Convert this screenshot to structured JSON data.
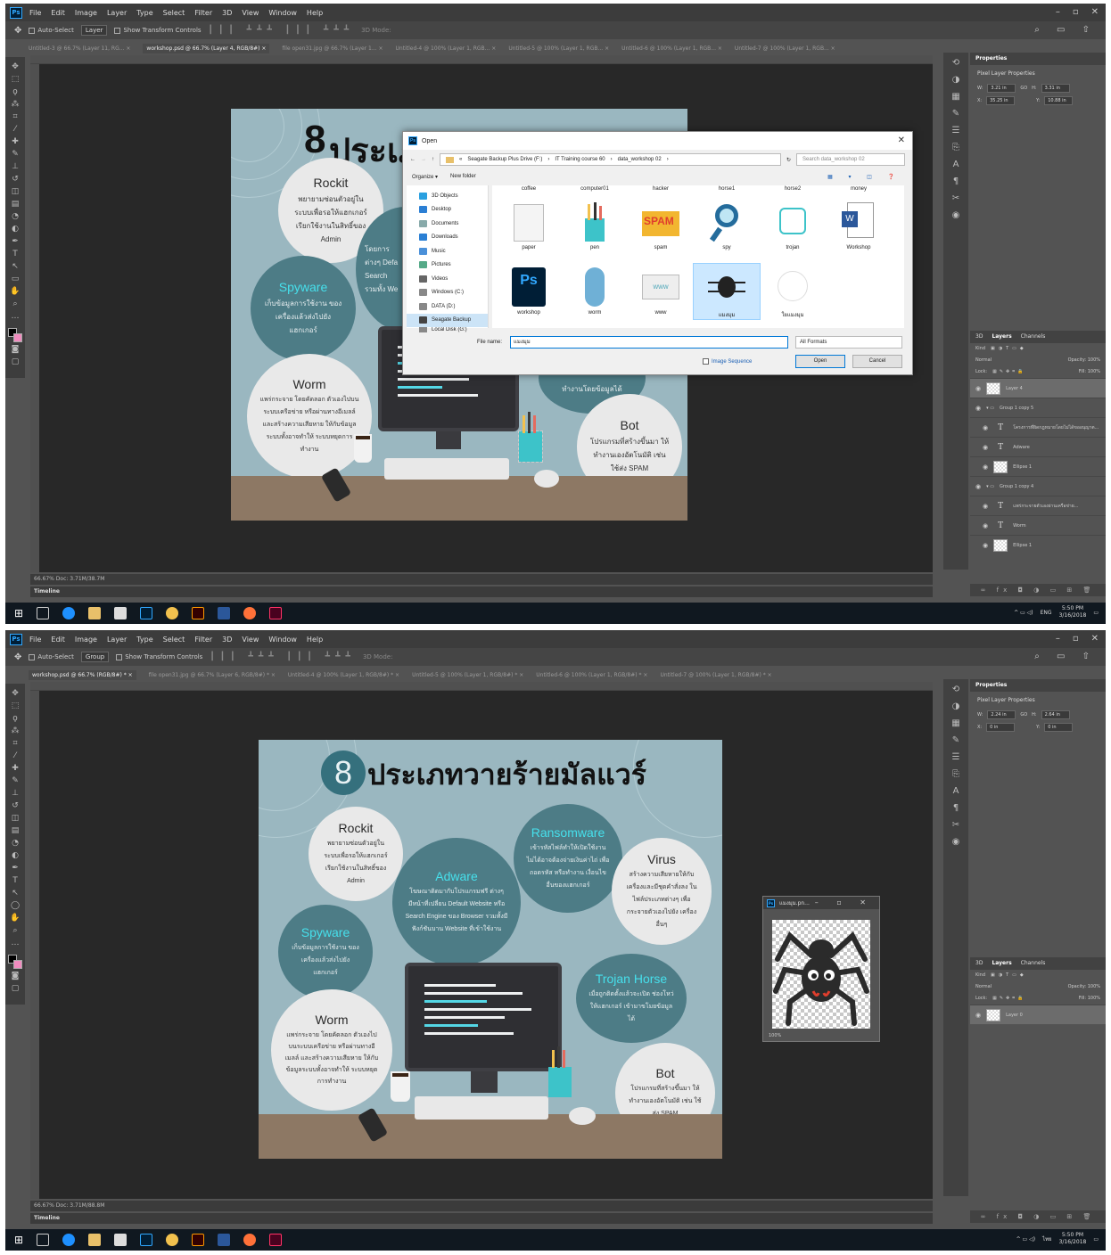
{
  "menu": [
    "File",
    "Edit",
    "Image",
    "Layer",
    "Type",
    "Select",
    "Filter",
    "3D",
    "View",
    "Window",
    "Help"
  ],
  "window_controls": [
    "–",
    "▫",
    "✕"
  ],
  "taskbar": {
    "time": "5:50 PM",
    "date": "3/16/2018",
    "lang1": "ENG",
    "time2": "5:50 PM",
    "date2": "3/16/2018",
    "lang2": "ไทย"
  },
  "shot1": {
    "options": {
      "auto_select": "Auto-Select",
      "target": "Layer",
      "transform": "Show Transform Controls",
      "mode3d": "3D Mode:"
    },
    "tabs": [
      "Untitled-3 @ 66.7% (Layer 11, RG... ×",
      "workshop.psd @ 66.7% (Layer 4, RGB/8#) ×",
      "file open31.jpg @ 66.7% (Layer 1... ×",
      "Untitled-4 @ 100% (Layer 1, RGB... ×",
      "Untitled-5 @ 100% (Layer 1, RGB... ×",
      "Untitled-6 @ 100% (Layer 1, RGB... ×",
      "Untitled-7 @ 100% (Layer 1, RGB... ×"
    ],
    "status": "66.67%      Doc: 3.71M/38.7M",
    "timeline": "Timeline",
    "properties": {
      "title": "Properties",
      "sub": "Pixel Layer Properties",
      "w_label": "W:",
      "w": "3.21 in",
      "go": "GO",
      "h_label": "H:",
      "h": "3.31 in",
      "x_label": "X:",
      "x": "35.25 in",
      "y_label": "Y:",
      "y": "10.88 in"
    },
    "layers_tabs": [
      "3D",
      "Layers",
      "Channels"
    ],
    "layers_ctrl": {
      "kind": "Kind",
      "blend": "Normal",
      "opacity": "Opacity: 100%",
      "lock": "Lock:",
      "fill": "Fill: 100%"
    },
    "layers": [
      {
        "name": "Layer 4",
        "type": "pixel"
      },
      {
        "name": "Group 1 copy 5",
        "type": "group"
      },
      {
        "name": "โครงการที่ผิดกฎหมายโดยไม่ได้ขออนุญาต...",
        "type": "text"
      },
      {
        "name": "Adware",
        "type": "text"
      },
      {
        "name": "Ellipse 1",
        "type": "pixel"
      },
      {
        "name": "Group 1 copy 4",
        "type": "group"
      },
      {
        "name": "แพร่กระจายตัวเองผ่านเครือข่าย...",
        "type": "text"
      },
      {
        "name": "Worm",
        "type": "text"
      },
      {
        "name": "Ellipse 1",
        "type": "pixel"
      }
    ],
    "dialog": {
      "title": "Open",
      "path": [
        "«",
        "Seagate Backup Plus Drive (F:)",
        "›",
        "IT Training course 60",
        "›",
        "data_workshop 02",
        "›"
      ],
      "search": "Search data_workshop 02",
      "organize": "Organize ▾",
      "new_folder": "New folder",
      "nav": [
        "3D Objects",
        "Desktop",
        "Documents",
        "Downloads",
        "Music",
        "Pictures",
        "Videos",
        "Windows (C:)",
        "DATA (D:)",
        "Seagate Backup",
        "Local Disk (G:)"
      ],
      "top_row": [
        "coffee",
        "computer01",
        "hacker",
        "horse1",
        "horse2",
        "money"
      ],
      "files": [
        "paper",
        "pen",
        "spam",
        "spy",
        "trojan",
        "Workshop"
      ],
      "files2": [
        "workshop",
        "worm",
        "www",
        "แมงมุม",
        "ใยแมงมุม"
      ],
      "filename_label": "File name:",
      "filename": "แมงมุม",
      "filter": "All Formats",
      "image_sequence": "Image Sequence",
      "open": "Open",
      "cancel": "Cancel"
    },
    "doc": {
      "num": "8",
      "title": "ประเภท"
    },
    "bubbles": [
      {
        "title": "Rockit",
        "body": "พยายามซ่อนตัวอยู่ใน ระบบเพื่อรอให้แฮกเกอร์ เรียกใช้งานในสิทธิ์ของ Admin"
      },
      {
        "title": "Spyware",
        "body": "เก็บข้อมูลการใช้งาน ของเครื่องแล้วส่งไปยัง แฮกเกอร์"
      },
      {
        "title": "Worm",
        "body": "แพร่กระจาย โดยคัดลอก ตัวเองไปบนระบบเครือข่าย หรือผ่านทางอีเมลล์ และสร้างความเสียหาย ให้กับข้อมูลระบบทั้งอาจทำให้ ระบบหยุดการทำงาน"
      },
      {
        "title": "Bot",
        "body": "โปรแกรมที่สร้างขึ้นมา ให้ทำงานเองอัตโนมัติ เช่น ใช้ส่ง SPAM"
      },
      {
        "title": "",
        "body": "ทำงานโดยข้อมูลได้"
      },
      {
        "title": "",
        "body": "โดยการ ต่างๆ Defa Search รวมทั้ง We"
      }
    ]
  },
  "shot2": {
    "options": {
      "auto_select": "Auto-Select",
      "target": "Group",
      "transform": "Show Transform Controls",
      "mode3d": "3D Mode:"
    },
    "tabs": [
      "workshop.psd @ 66.7% (RGB/8#) * ×",
      "file open31.jpg @ 66.7% (Layer 6, RGB/8#) * ×",
      "Untitled-4 @ 100% (Layer 1, RGB/8#) * ×",
      "Untitled-5 @ 100% (Layer 1, RGB/8#) * ×",
      "Untitled-6 @ 100% (Layer 1, RGB/8#) * ×",
      "Untitled-7 @ 100% (Layer 1, RGB/8#) * ×"
    ],
    "status": "66.67%      Doc: 3.71M/88.8M",
    "timeline": "Timeline",
    "properties": {
      "title": "Properties",
      "sub": "Pixel Layer Properties",
      "w_label": "W:",
      "w": "2.24 in",
      "go": "GO",
      "h_label": "H:",
      "h": "2.64 in",
      "x_label": "X:",
      "x": "0 in",
      "y_label": "Y:",
      "y": "0 in"
    },
    "layers_tabs": [
      "3D",
      "Layers",
      "Channels"
    ],
    "layers_ctrl": {
      "kind": "Kind",
      "blend": "Normal",
      "opacity": "Opacity: 100%",
      "lock": "Lock:",
      "fill": "Fill: 100%"
    },
    "layers": [
      {
        "name": "Layer 0",
        "type": "pixel"
      }
    ],
    "floatwin": {
      "title": "แมงมุม.pn...",
      "zoom": "100%"
    },
    "doc": {
      "num": "8",
      "title": "ประเภทวายร้ายมัลแวร์"
    },
    "bubbles": [
      {
        "title": "Rockit",
        "body": "พยายามซ่อนตัวอยู่ใน ระบบเพื่อรอให้แฮกเกอร์ เรียกใช้งานในสิทธิ์ของ Admin"
      },
      {
        "title": "Adware",
        "body": "โฆษณาติดมากับโปรแกรมฟรี ต่างๆ มีหน้าที่เปลี่ยน Default Website หรือ Search Engine ของ Browser รวมทั้งมีฟังก์ชันบาน Website ที่เข้าใช้งาน"
      },
      {
        "title": "Ransomware",
        "body": "เข้ารหัสไฟล์ทำให้เปิดใช้งาน ไม่ได้อาจต้องจ่ายเงินค่าไถ่ เพื่อถอดรหัส หรือทำงาน เงื่อนไขอื่นของแฮกเกอร์"
      },
      {
        "title": "Virus",
        "body": "สร้างความเสียหายให้กับ เครื่องและมีชุดคำสั่งลง ในไฟล์ประเภทต่างๆ เพื่อ กระจายตัวเองไปยัง เครื่องอื่นๆ"
      },
      {
        "title": "Spyware",
        "body": "เก็บข้อมูลการใช้งาน ของเครื่องแล้วส่งไปยัง แฮกเกอร์"
      },
      {
        "title": "Trojan Horse",
        "body": "เมื่อถูกติดตั้งแล้วจะเปิด ช่องโหว่ให้แฮกเกอร์ เข้ามาขโมยข้อมูลได้"
      },
      {
        "title": "Worm",
        "body": "แพร่กระจาย โดยคัดลอก ตัวเองไปบนระบบเครือข่าย หรือผ่านทางอีเมลล์ และสร้างความเสียหาย ให้กับข้อมูลระบบทั้งอาจทำให้ ระบบหยุดการทำงาน"
      },
      {
        "title": "Bot",
        "body": "โปรแกรมที่สร้างขึ้นมา ให้ทำงานเองอัตโนมัติ เช่น ใช้ส่ง SPAM"
      }
    ]
  },
  "colors": {
    "ps_bg": "#535353",
    "canvas": "#282828",
    "doc_bg": "#9ab7c0",
    "bubble_dark": "#4d7c86",
    "accent_cyan": "#46e0ec",
    "desk": "#8d7864",
    "taskbar": "#101820"
  },
  "icons": [
    "photoshop-icon",
    "move-tool-icon",
    "search-icon",
    "windows-start-icon",
    "folder-icon",
    "spider-icon"
  ]
}
